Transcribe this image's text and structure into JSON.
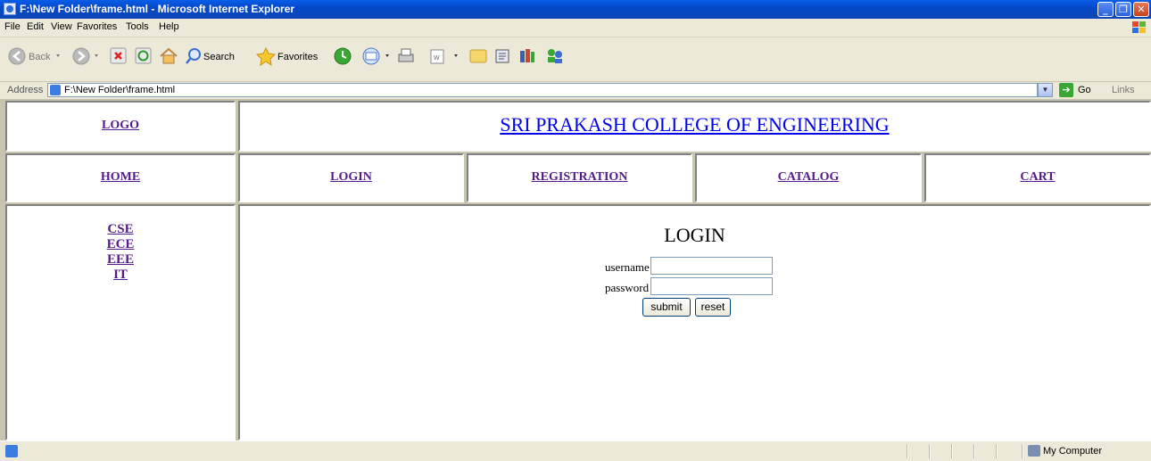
{
  "window": {
    "title": "F:\\New Folder\\frame.html - Microsoft Internet Explorer"
  },
  "menu": [
    "File",
    "Edit",
    "View",
    "Favorites",
    "Tools",
    "Help"
  ],
  "toolbar": {
    "back": "Back",
    "search": "Search",
    "favorites": "Favorites"
  },
  "address": {
    "label": "Address",
    "url": "F:\\New Folder\\frame.html",
    "go": "Go",
    "links": "Links"
  },
  "header": {
    "logo": "LOGO",
    "college": "SRI PRAKASH COLLEGE OF ENGINEERING"
  },
  "nav": [
    "HOME",
    "LOGIN",
    "REGISTRATION",
    "CATALOG",
    "CART"
  ],
  "departments": [
    "CSE",
    "ECE",
    "EEE",
    "IT"
  ],
  "login": {
    "heading": "LOGIN",
    "username_label": "username",
    "password_label": "password",
    "username_value": "",
    "password_value": "",
    "submit": "submit",
    "reset": "reset"
  },
  "status": {
    "zone": "My Computer"
  }
}
